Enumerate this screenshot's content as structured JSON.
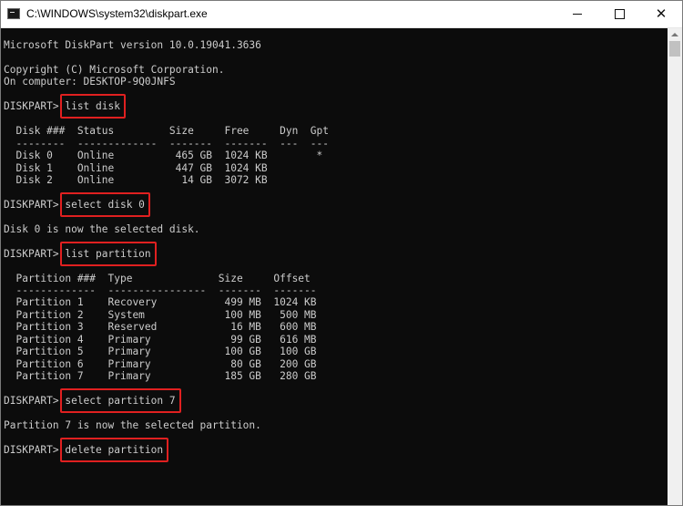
{
  "window": {
    "title": "C:\\WINDOWS\\system32\\diskpart.exe",
    "minimize_glyph": "",
    "maximize_glyph": "",
    "close_glyph": "✕"
  },
  "icons": {
    "app": "console-app-icon",
    "minimize": "minimize-icon",
    "maximize": "maximize-icon",
    "close": "close-icon"
  },
  "colors": {
    "console_background": "#0c0c0c",
    "console_text": "#cccccc",
    "highlight_box": "#e02020",
    "titlebar": "#ffffff"
  },
  "console": {
    "lines": [
      "Microsoft DiskPart version 10.0.19041.3636",
      "",
      "Copyright (C) Microsoft Corporation.",
      "On computer: DESKTOP-9Q0JNFS",
      "",
      "DISKPART> list disk",
      "",
      "  Disk ###  Status         Size     Free     Dyn  Gpt",
      "  --------  -------------  -------  -------  ---  ---",
      "  Disk 0    Online          465 GB  1024 KB        *",
      "  Disk 1    Online          447 GB  1024 KB",
      "  Disk 2    Online           14 GB  3072 KB",
      "",
      "DISKPART> select disk 0",
      "",
      "Disk 0 is now the selected disk.",
      "",
      "DISKPART> list partition",
      "",
      "  Partition ###  Type              Size     Offset",
      "  -------------  ----------------  -------  -------",
      "  Partition 1    Recovery           499 MB  1024 KB",
      "  Partition 2    System             100 MB   500 MB",
      "  Partition 3    Reserved            16 MB   600 MB",
      "  Partition 4    Primary             99 GB   616 MB",
      "  Partition 5    Primary            100 GB   100 GB",
      "  Partition 6    Primary             80 GB   200 GB",
      "  Partition 7    Primary            185 GB   280 GB",
      "",
      "DISKPART> select partition 7",
      "",
      "Partition 7 is now the selected partition.",
      "",
      "DISKPART> delete partition"
    ],
    "highlighted_commands": [
      {
        "line": 5,
        "text": "list disk"
      },
      {
        "line": 13,
        "text": "select disk 0"
      },
      {
        "line": 17,
        "text": "list partition"
      },
      {
        "line": 29,
        "text": "select partition 7"
      },
      {
        "line": 33,
        "text": "delete partition"
      }
    ]
  }
}
